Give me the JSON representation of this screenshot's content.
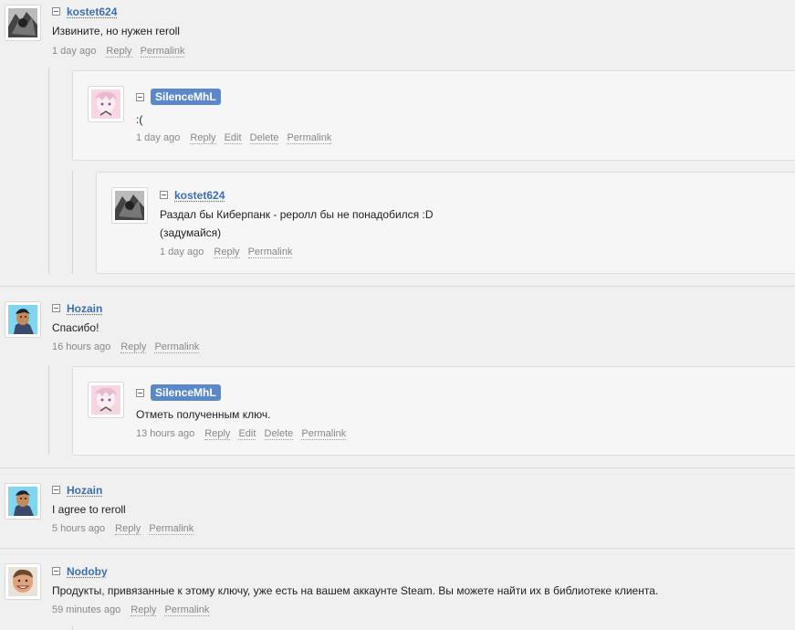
{
  "comments": [
    {
      "user": "kostet624",
      "text": "Извините, но нужен reroll",
      "time": "1 day ago",
      "actions": [
        "Reply",
        "Permalink"
      ]
    },
    {
      "user": "SilenceMhL",
      "text": ":(",
      "time": "1 day ago",
      "actions": [
        "Reply",
        "Edit",
        "Delete",
        "Permalink"
      ]
    },
    {
      "user": "kostet624",
      "text": "Раздал бы Киберпанк - реролл бы не понадобился :D",
      "text2": "(задумайся)",
      "time": "1 day ago",
      "actions": [
        "Reply",
        "Permalink"
      ]
    },
    {
      "user": "Hozain",
      "text": "Спасибо!",
      "time": "16 hours ago",
      "actions": [
        "Reply",
        "Permalink"
      ]
    },
    {
      "user": "SilenceMhL",
      "text": "Отметь полученным ключ.",
      "time": "13 hours ago",
      "actions": [
        "Reply",
        "Edit",
        "Delete",
        "Permalink"
      ]
    },
    {
      "user": "Hozain",
      "text": "I agree to reroll",
      "time": "5 hours ago",
      "actions": [
        "Reply",
        "Permalink"
      ]
    },
    {
      "user": "Nodoby",
      "text": "Продукты, привязанные к этому ключу, уже есть на вашем аккаунте Steam. Вы можете найти их в библиотеке клиента.",
      "time": "59 minutes ago",
      "actions": [
        "Reply",
        "Permalink"
      ]
    }
  ],
  "icons": {
    "collapse": "collapse-minus-icon"
  },
  "colors": {
    "username": "#3d6fa8",
    "badge_bg": "#5b88c9",
    "meta": "#888888"
  }
}
